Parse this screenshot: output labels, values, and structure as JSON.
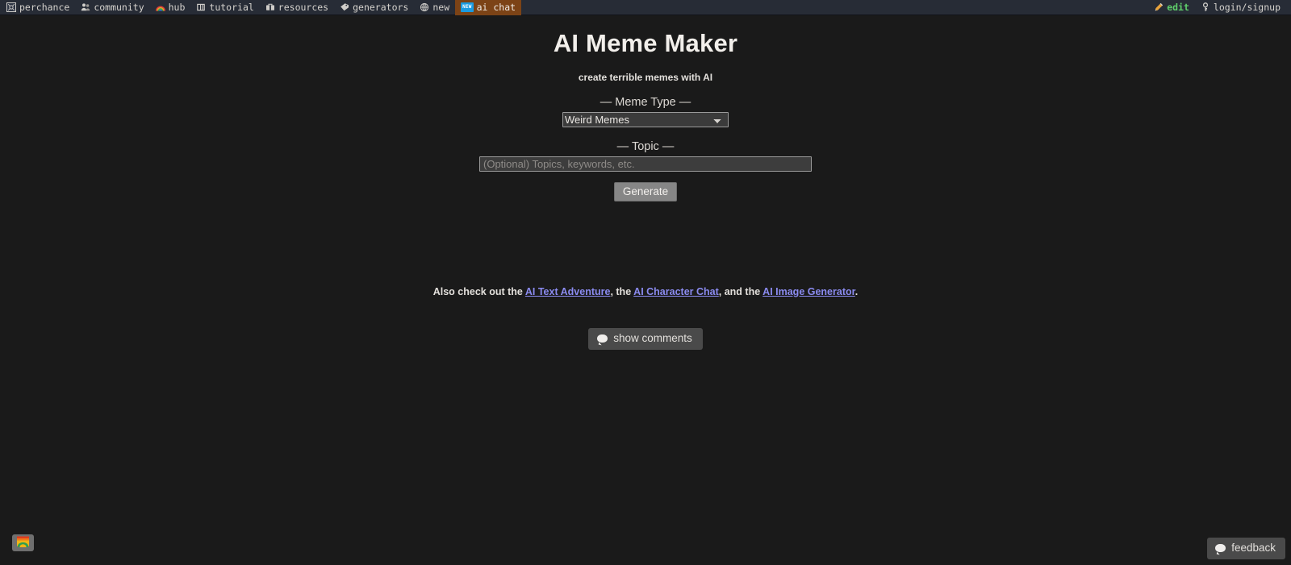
{
  "topbar": {
    "left_items": [
      {
        "icon": "perchance-logo-icon",
        "label": "perchance"
      },
      {
        "icon": "people-icon",
        "label": "community"
      },
      {
        "icon": "rainbow-icon",
        "label": "hub"
      },
      {
        "icon": "book-icon",
        "label": "tutorial"
      },
      {
        "icon": "toolbox-icon",
        "label": "resources"
      },
      {
        "icon": "tag-icon",
        "label": "generators"
      },
      {
        "icon": "globe-icon",
        "label": "new"
      },
      {
        "icon": "new-badge-icon",
        "label": "ai chat",
        "badge": "NEW",
        "active": true
      }
    ],
    "right_items": [
      {
        "icon": "pencil-icon",
        "label": "edit"
      },
      {
        "icon": "key-icon",
        "label": "login/signup"
      }
    ],
    "colors": {
      "bar_bg": "#272c36",
      "active_tab_bg": "#7c4316",
      "badge_bg": "#1b9be0",
      "edit_text": "#5fcf6b"
    }
  },
  "main": {
    "title": "AI Meme Maker",
    "subtitle": "create terrible memes with AI",
    "meme_type": {
      "label": "— Meme Type —",
      "selected": "Weird Memes",
      "options": [
        "Weird Memes"
      ]
    },
    "topic": {
      "label": "— Topic —",
      "value": "",
      "placeholder": "(Optional) Topics, keywords, etc."
    },
    "generate_label": "Generate",
    "also_check": {
      "prefix": "Also check out the ",
      "link1": "AI Text Adventure",
      "mid1": ", the ",
      "link2": "AI Character Chat",
      "mid2": ", and the ",
      "link3": "AI Image Generator",
      "suffix": ".",
      "link_color": "#8b8bf0"
    },
    "show_comments_label": "show comments"
  },
  "footer": {
    "image_widget_name": "image-thumbnail-button",
    "feedback_label": "feedback"
  },
  "theme": {
    "page_bg": "#1a1a1a",
    "text": "#e8e6e3"
  }
}
